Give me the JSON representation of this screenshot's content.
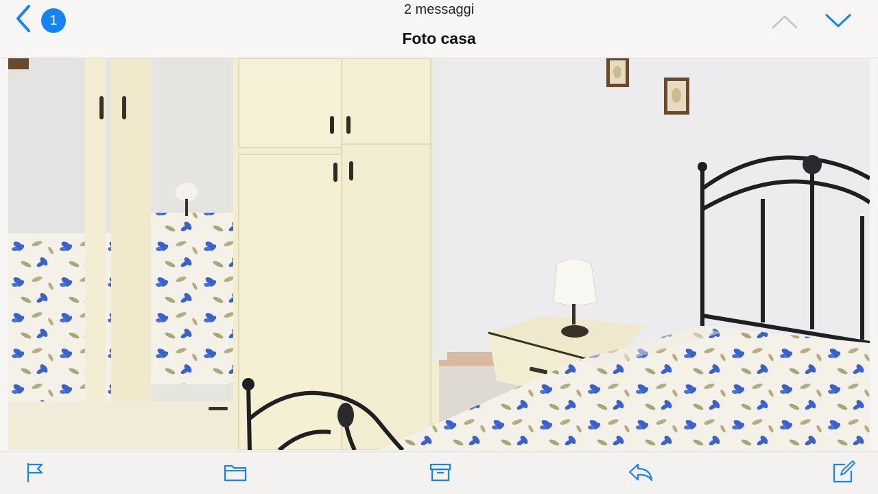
{
  "header": {
    "back_badge_count": "1",
    "subtitle": "2 messaggi",
    "title": "Foto casa"
  },
  "colors": {
    "accent": "#1582f6",
    "disabled": "#c9c9cc"
  },
  "icons": {
    "back": "chevron-left-icon",
    "prev_message": "chevron-up-icon",
    "next_message": "chevron-down-icon",
    "flag": "flag-icon",
    "folder": "folder-icon",
    "archive": "archive-icon",
    "reply": "reply-icon",
    "compose": "compose-icon"
  }
}
